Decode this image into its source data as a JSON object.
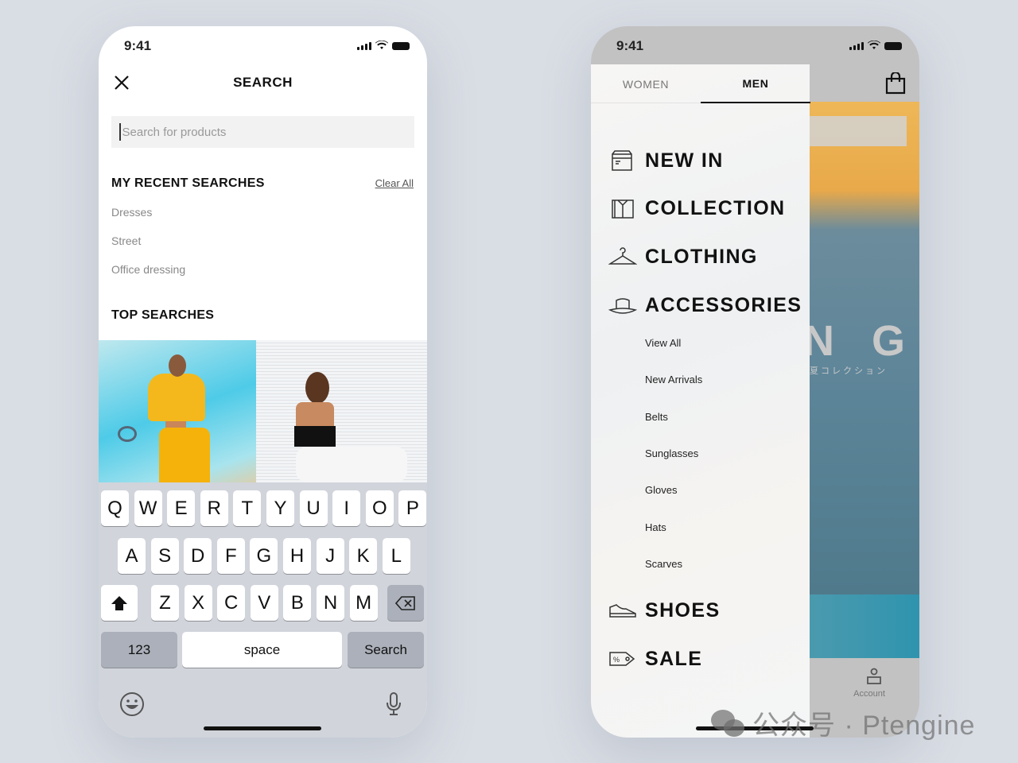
{
  "search_screen": {
    "status": {
      "time": "9:41"
    },
    "title": "SEARCH",
    "search_placeholder": "Search for products",
    "recent_heading": "MY RECENT SEARCHES",
    "clear_all": "Clear All",
    "recent": [
      "Dresses",
      "Street",
      "Office dressing"
    ],
    "top_heading": "TOP SEARCHES",
    "keyboard": {
      "row1": [
        "Q",
        "W",
        "E",
        "R",
        "T",
        "Y",
        "U",
        "I",
        "O",
        "P"
      ],
      "row2": [
        "A",
        "S",
        "D",
        "F",
        "G",
        "H",
        "J",
        "K",
        "L"
      ],
      "row3": [
        "Z",
        "X",
        "C",
        "V",
        "B",
        "N",
        "M"
      ],
      "numbers": "123",
      "space": "space",
      "search": "Search"
    }
  },
  "menu_screen": {
    "status": {
      "time": "9:41"
    },
    "tabs": [
      {
        "label": "WOMEN",
        "active": false
      },
      {
        "label": "MEN",
        "active": true
      }
    ],
    "categories": [
      {
        "label": "NEW IN",
        "icon": "box-icon"
      },
      {
        "label": "COLLECTION",
        "icon": "shirt-icon"
      },
      {
        "label": "CLOTHING",
        "icon": "hanger-icon"
      },
      {
        "label": "ACCESSORIES",
        "icon": "hat-icon"
      }
    ],
    "accessories_sub": [
      "View All",
      "New Arrivals",
      "Belts",
      "Sunglasses",
      "Gloves",
      "Hats",
      "Scarves"
    ],
    "bottom_categories": [
      {
        "label": "SHOES",
        "icon": "shoe-icon"
      },
      {
        "label": "SALE",
        "icon": "tag-icon"
      }
    ],
    "banner_text": "N G",
    "banner_sub": "夏コレクション",
    "account_label": "Account"
  },
  "watermark": "公众号 · Ptengine",
  "colors": {
    "keyboard_bg": "#d1d4db",
    "dark_key": "#abb0ba",
    "teal": "#3f9bb0"
  }
}
